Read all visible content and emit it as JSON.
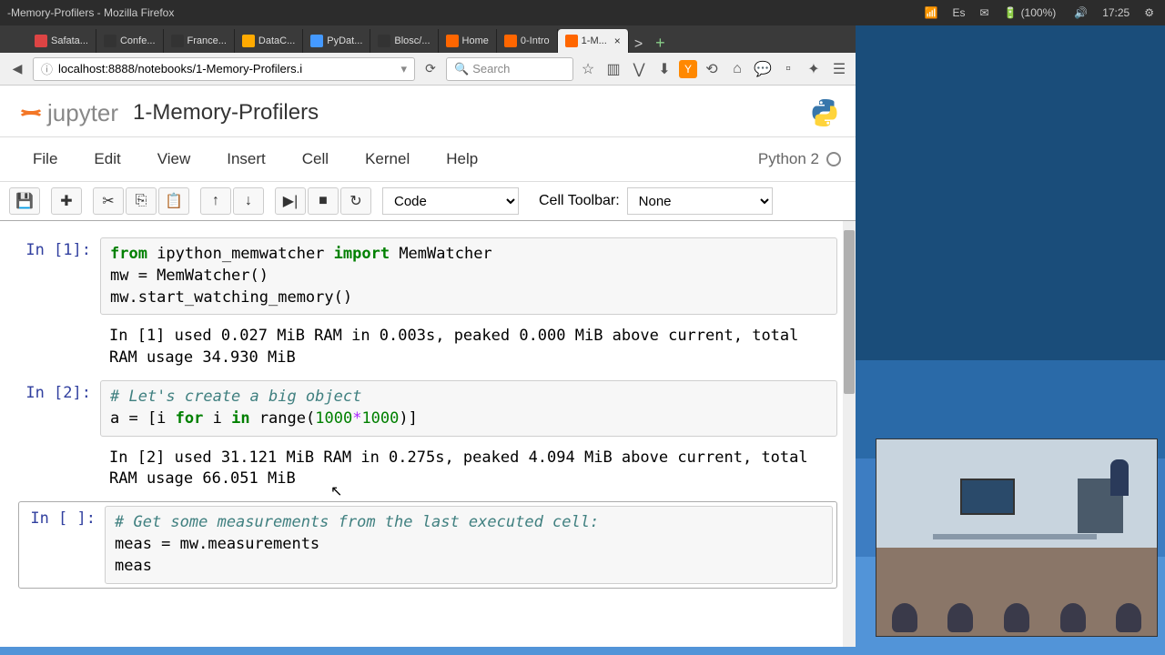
{
  "top_bar": {
    "title": "-Memory-Profilers - Mozilla Firefox",
    "language": "Es",
    "battery": "(100%)",
    "time": "17:25"
  },
  "tabs": [
    {
      "label": "Safata...",
      "color": "#d44"
    },
    {
      "label": "Confe...",
      "color": "#333"
    },
    {
      "label": "France...",
      "color": "#333"
    },
    {
      "label": "DataC...",
      "color": "#fa0"
    },
    {
      "label": "PyDat...",
      "color": "#49f"
    },
    {
      "label": "Blosc/...",
      "color": "#333"
    },
    {
      "label": "Home",
      "color": "#f60"
    },
    {
      "label": "0-Intro",
      "color": "#f60"
    },
    {
      "label": "1-M...",
      "color": "#f60",
      "active": true
    }
  ],
  "url": "localhost:8888/notebooks/1-Memory-Profilers.i",
  "search_placeholder": "Search",
  "notebook": {
    "logo": "jupyter",
    "title": "1-Memory-Profilers",
    "kernel": "Python 2"
  },
  "menu": [
    "File",
    "Edit",
    "View",
    "Insert",
    "Cell",
    "Kernel",
    "Help"
  ],
  "toolbar": {
    "cell_type": "Code",
    "cell_toolbar_label": "Cell Toolbar:",
    "cell_toolbar_value": "None"
  },
  "cells": [
    {
      "prompt": "In [1]:",
      "code_html": "<span class='code-kw'>from</span> ipython_memwatcher <span class='code-kw'>import</span> MemWatcher\nmw = MemWatcher()\nmw.start_watching_memory()"
    },
    {
      "output": true,
      "text": "In [1] used 0.027 MiB RAM in 0.003s, peaked 0.000 MiB above current, total RAM usage 34.930 MiB"
    },
    {
      "prompt": "In [2]:",
      "code_html": "<span class='code-cm'># Let's create a big object</span>\na = [i <span class='code-kw2'>for</span> i <span class='code-kw2'>in</span> range(<span class='code-num'>1000</span><span class='code-op'>*</span><span class='code-num'>1000</span>)]"
    },
    {
      "output": true,
      "text": "In [2] used 31.121 MiB RAM in 0.275s, peaked 4.094 MiB above current, total RAM usage 66.051 MiB"
    },
    {
      "prompt": "In [ ]:",
      "selected": true,
      "code_html": "<span class='code-cm'># Get some measurements from the last executed cell:</span>\nmeas = mw.measurements\nmeas"
    }
  ]
}
